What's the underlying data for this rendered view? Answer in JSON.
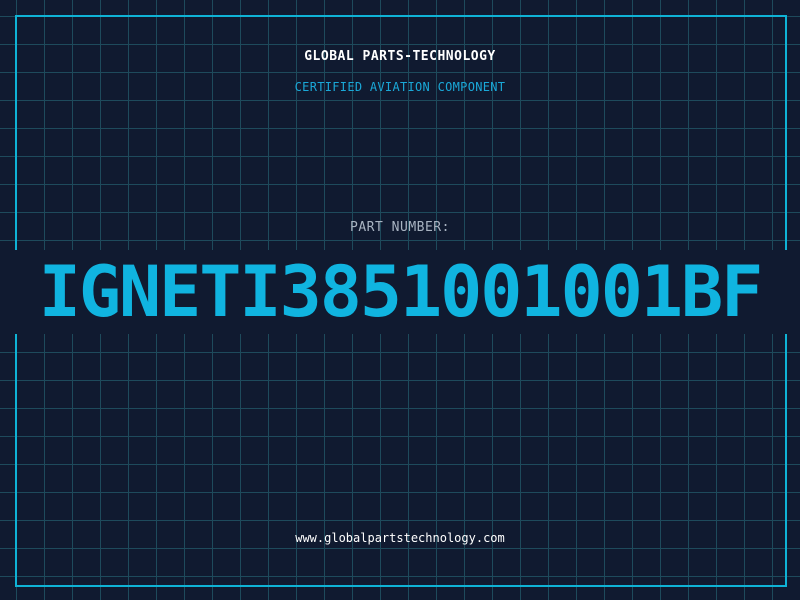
{
  "header": {
    "company": "GLOBAL PARTS-TECHNOLOGY",
    "subtitle": "CERTIFIED AVIATION COMPONENT"
  },
  "part": {
    "label": "PART NUMBER:",
    "number": "IGNETI3851001001BF"
  },
  "footer": {
    "url": "www.globalpartstechnology.com"
  },
  "colors": {
    "background": "#101a30",
    "grid": "#1e4a5c",
    "accent": "#0fb3d6",
    "part_number": "#10b4e0",
    "title": "#ffffff",
    "label": "#a9b4c2"
  }
}
